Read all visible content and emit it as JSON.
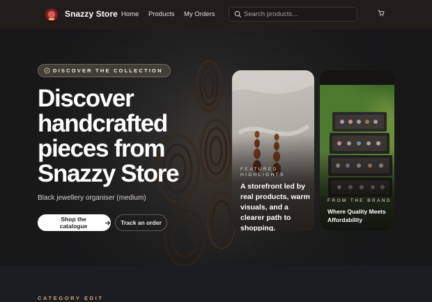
{
  "nav": {
    "brand": "Snazzy Store",
    "links": [
      "Home",
      "Products",
      "My Orders"
    ],
    "search_placeholder": "Search products...",
    "cart_icon": "cart-icon"
  },
  "hero": {
    "badge": "DISCOVER THE COLLECTION",
    "title": "Discover handcrafted pieces from Snazzy Store",
    "subtitle": "Black jewellery organiser (medium)",
    "primary_button": "Shop the catalogue",
    "secondary_button": "Track an order",
    "card_featured": {
      "kicker": "FEATURED HIGHLIGHTS",
      "text": "A storefront led by real products, warm visuals, and a clearer path to shopping."
    },
    "card_brand": {
      "kicker": "FROM THE BRAND",
      "text": "Where Quality Meets Affordability"
    }
  },
  "section": {
    "kicker": "CATEGORY EDIT"
  },
  "colors": {
    "nav_bg": "#221d1a",
    "accent_kicker": "#d3a57c"
  }
}
